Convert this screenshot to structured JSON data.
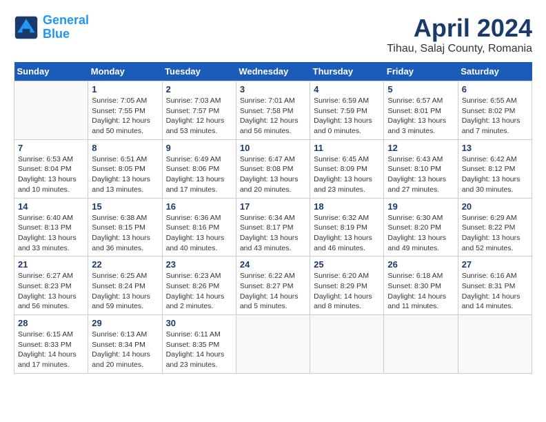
{
  "header": {
    "logo_general": "General",
    "logo_blue": "Blue",
    "month_title": "April 2024",
    "location": "Tihau, Salaj County, Romania"
  },
  "days_of_week": [
    "Sunday",
    "Monday",
    "Tuesday",
    "Wednesday",
    "Thursday",
    "Friday",
    "Saturday"
  ],
  "weeks": [
    [
      {
        "day": "",
        "info": ""
      },
      {
        "day": "1",
        "info": "Sunrise: 7:05 AM\nSunset: 7:55 PM\nDaylight: 12 hours\nand 50 minutes."
      },
      {
        "day": "2",
        "info": "Sunrise: 7:03 AM\nSunset: 7:57 PM\nDaylight: 12 hours\nand 53 minutes."
      },
      {
        "day": "3",
        "info": "Sunrise: 7:01 AM\nSunset: 7:58 PM\nDaylight: 12 hours\nand 56 minutes."
      },
      {
        "day": "4",
        "info": "Sunrise: 6:59 AM\nSunset: 7:59 PM\nDaylight: 13 hours\nand 0 minutes."
      },
      {
        "day": "5",
        "info": "Sunrise: 6:57 AM\nSunset: 8:01 PM\nDaylight: 13 hours\nand 3 minutes."
      },
      {
        "day": "6",
        "info": "Sunrise: 6:55 AM\nSunset: 8:02 PM\nDaylight: 13 hours\nand 7 minutes."
      }
    ],
    [
      {
        "day": "7",
        "info": "Sunrise: 6:53 AM\nSunset: 8:04 PM\nDaylight: 13 hours\nand 10 minutes."
      },
      {
        "day": "8",
        "info": "Sunrise: 6:51 AM\nSunset: 8:05 PM\nDaylight: 13 hours\nand 13 minutes."
      },
      {
        "day": "9",
        "info": "Sunrise: 6:49 AM\nSunset: 8:06 PM\nDaylight: 13 hours\nand 17 minutes."
      },
      {
        "day": "10",
        "info": "Sunrise: 6:47 AM\nSunset: 8:08 PM\nDaylight: 13 hours\nand 20 minutes."
      },
      {
        "day": "11",
        "info": "Sunrise: 6:45 AM\nSunset: 8:09 PM\nDaylight: 13 hours\nand 23 minutes."
      },
      {
        "day": "12",
        "info": "Sunrise: 6:43 AM\nSunset: 8:10 PM\nDaylight: 13 hours\nand 27 minutes."
      },
      {
        "day": "13",
        "info": "Sunrise: 6:42 AM\nSunset: 8:12 PM\nDaylight: 13 hours\nand 30 minutes."
      }
    ],
    [
      {
        "day": "14",
        "info": "Sunrise: 6:40 AM\nSunset: 8:13 PM\nDaylight: 13 hours\nand 33 minutes."
      },
      {
        "day": "15",
        "info": "Sunrise: 6:38 AM\nSunset: 8:15 PM\nDaylight: 13 hours\nand 36 minutes."
      },
      {
        "day": "16",
        "info": "Sunrise: 6:36 AM\nSunset: 8:16 PM\nDaylight: 13 hours\nand 40 minutes."
      },
      {
        "day": "17",
        "info": "Sunrise: 6:34 AM\nSunset: 8:17 PM\nDaylight: 13 hours\nand 43 minutes."
      },
      {
        "day": "18",
        "info": "Sunrise: 6:32 AM\nSunset: 8:19 PM\nDaylight: 13 hours\nand 46 minutes."
      },
      {
        "day": "19",
        "info": "Sunrise: 6:30 AM\nSunset: 8:20 PM\nDaylight: 13 hours\nand 49 minutes."
      },
      {
        "day": "20",
        "info": "Sunrise: 6:29 AM\nSunset: 8:22 PM\nDaylight: 13 hours\nand 52 minutes."
      }
    ],
    [
      {
        "day": "21",
        "info": "Sunrise: 6:27 AM\nSunset: 8:23 PM\nDaylight: 13 hours\nand 56 minutes."
      },
      {
        "day": "22",
        "info": "Sunrise: 6:25 AM\nSunset: 8:24 PM\nDaylight: 13 hours\nand 59 minutes."
      },
      {
        "day": "23",
        "info": "Sunrise: 6:23 AM\nSunset: 8:26 PM\nDaylight: 14 hours\nand 2 minutes."
      },
      {
        "day": "24",
        "info": "Sunrise: 6:22 AM\nSunset: 8:27 PM\nDaylight: 14 hours\nand 5 minutes."
      },
      {
        "day": "25",
        "info": "Sunrise: 6:20 AM\nSunset: 8:29 PM\nDaylight: 14 hours\nand 8 minutes."
      },
      {
        "day": "26",
        "info": "Sunrise: 6:18 AM\nSunset: 8:30 PM\nDaylight: 14 hours\nand 11 minutes."
      },
      {
        "day": "27",
        "info": "Sunrise: 6:16 AM\nSunset: 8:31 PM\nDaylight: 14 hours\nand 14 minutes."
      }
    ],
    [
      {
        "day": "28",
        "info": "Sunrise: 6:15 AM\nSunset: 8:33 PM\nDaylight: 14 hours\nand 17 minutes."
      },
      {
        "day": "29",
        "info": "Sunrise: 6:13 AM\nSunset: 8:34 PM\nDaylight: 14 hours\nand 20 minutes."
      },
      {
        "day": "30",
        "info": "Sunrise: 6:11 AM\nSunset: 8:35 PM\nDaylight: 14 hours\nand 23 minutes."
      },
      {
        "day": "",
        "info": ""
      },
      {
        "day": "",
        "info": ""
      },
      {
        "day": "",
        "info": ""
      },
      {
        "day": "",
        "info": ""
      }
    ]
  ]
}
